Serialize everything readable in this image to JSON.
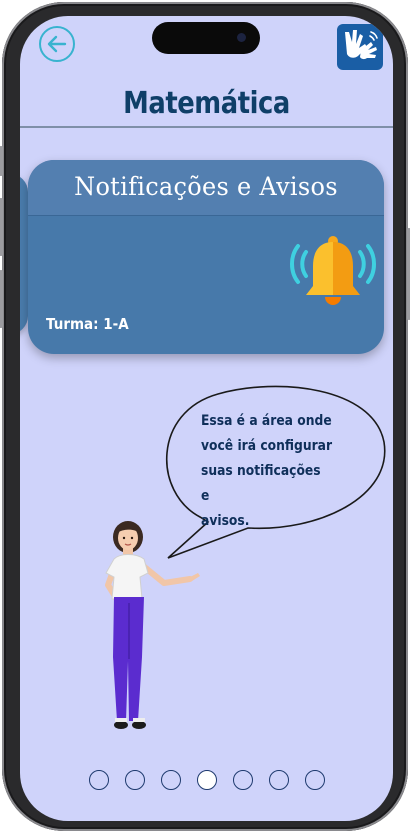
{
  "header": {
    "title": "Matemática"
  },
  "card": {
    "title": "Notificações e Avisos",
    "turma": "Turma: 1-A"
  },
  "speech": {
    "lines": [
      "Essa é a área onde",
      "você irá configurar",
      "suas notificações e",
      "avisos."
    ]
  },
  "pagination": {
    "total": 7,
    "active_index": 3
  },
  "icons": {
    "back": "arrow-left-circle-icon",
    "accessibility": "sign-language-hands-icon",
    "card": "ringing-bell-icon"
  },
  "colors": {
    "background": "#cfd3fa",
    "card": "#4779aa",
    "title": "#0f3f68",
    "accent": "#38b3cf",
    "bell": "#f7a81b"
  }
}
